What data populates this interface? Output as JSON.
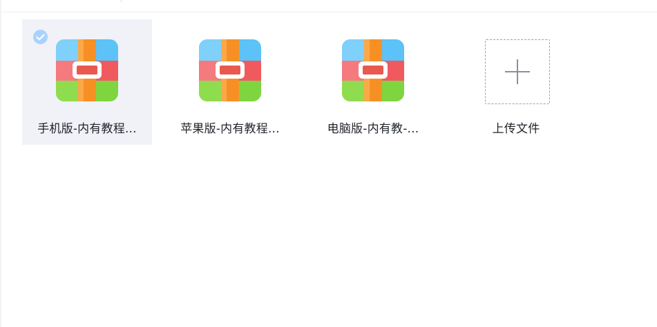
{
  "files": [
    {
      "name": "手机版-内有教程...",
      "selected": true
    },
    {
      "name": "苹果版-内有教程...",
      "selected": false
    },
    {
      "name": "电脑版-内有教-...",
      "selected": false
    }
  ],
  "upload": {
    "label": "上传文件"
  },
  "icons": {
    "archive": "archive-file-icon",
    "check": "check-icon",
    "plus": "plus-icon"
  },
  "colors": {
    "selected_bg": "#f0f2f7",
    "check_badge": "#a9d2ff",
    "archive_top": "#5cc2f7",
    "archive_middle": "#f05a5f",
    "archive_bottom": "#7fd53f",
    "archive_strap": "#f79024"
  }
}
